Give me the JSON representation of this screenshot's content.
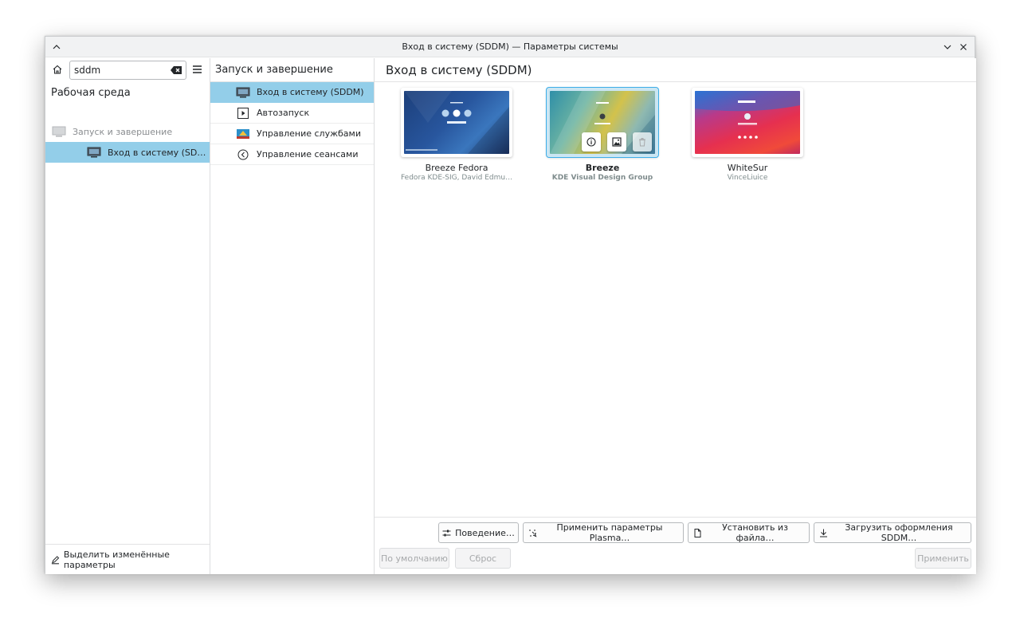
{
  "window": {
    "title": "Вход в систему (SDDM) — Параметры системы"
  },
  "sidebar": {
    "search_value": "sddm",
    "section_title": "Рабочая среда",
    "category_label": "Запуск и завершение",
    "selected_item_label": "Вход в систему (SD…",
    "footer_label": "Выделить изменённые параметры"
  },
  "middle": {
    "header": "Запуск и завершение",
    "items": [
      {
        "label": "Вход в систему (SDDM)",
        "icon": "monitor-icon",
        "selected": true
      },
      {
        "label": "Автозапуск",
        "icon": "autostart-icon",
        "selected": false
      },
      {
        "label": "Управление службами",
        "icon": "services-icon",
        "selected": false
      },
      {
        "label": "Управление сеансами",
        "icon": "session-icon",
        "selected": false
      }
    ]
  },
  "main": {
    "title": "Вход в систему (SDDM)",
    "themes": [
      {
        "name": "Breeze Fedora",
        "author": "Fedora KDE-SIG, David Edmu…",
        "current": false
      },
      {
        "name": "Breeze",
        "author": "KDE Visual Design Group",
        "current": true
      },
      {
        "name": "WhiteSur",
        "author": "VinceLiuice",
        "current": false
      }
    ],
    "toolbar": {
      "behavior": "Поведение…",
      "apply_plasma": "Применить параметры Plasma…",
      "install_file": "Установить из файла…",
      "download": "Загрузить оформления SDDM…"
    },
    "footer": {
      "defaults": "По умолчанию",
      "reset": "Сброс",
      "apply": "Применить"
    }
  },
  "colors": {
    "selection": "#93cee9",
    "accent": "#3daee9"
  }
}
